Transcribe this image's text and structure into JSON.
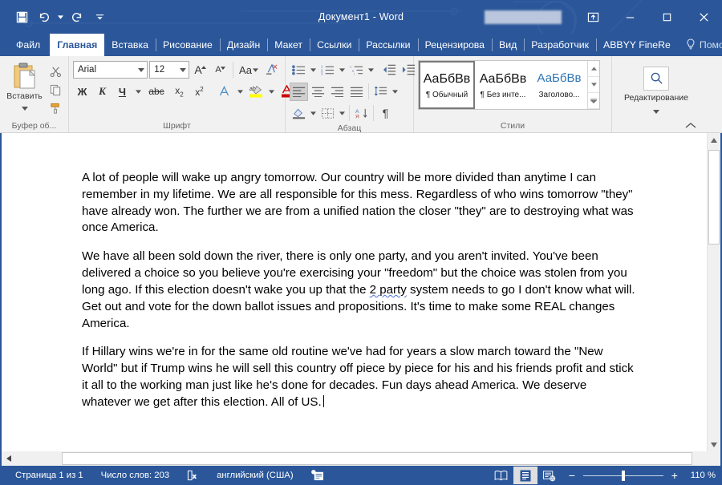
{
  "window": {
    "title": "Документ1  -  Word",
    "redacted_label": "",
    "quick_access": [
      {
        "name": "save",
        "icon": "save-icon"
      },
      {
        "name": "undo",
        "icon": "undo-icon"
      },
      {
        "name": "redo",
        "icon": "redo-icon"
      },
      {
        "name": "customize",
        "icon": "customize-qat-icon"
      }
    ],
    "controls": [
      {
        "name": "ribbon-display-options",
        "icon": "ribbon-options-icon"
      },
      {
        "name": "minimize",
        "icon": "minimize-icon"
      },
      {
        "name": "maximize",
        "icon": "maximize-icon"
      },
      {
        "name": "close",
        "icon": "close-icon"
      }
    ],
    "accent_color": "#2b579a"
  },
  "tabs": [
    {
      "label": "Файл",
      "active": false,
      "file": true
    },
    {
      "label": "Главная",
      "active": true
    },
    {
      "label": "Вставка",
      "active": false
    },
    {
      "label": "Рисование",
      "active": false
    },
    {
      "label": "Дизайн",
      "active": false
    },
    {
      "label": "Макет",
      "active": false
    },
    {
      "label": "Ссылки",
      "active": false
    },
    {
      "label": "Рассылки",
      "active": false
    },
    {
      "label": "Рецензирова",
      "active": false
    },
    {
      "label": "Вид",
      "active": false
    },
    {
      "label": "Разработчик",
      "active": false
    },
    {
      "label": "ABBYY FineRe",
      "active": false
    }
  ],
  "tell_me": {
    "label": "Помощн",
    "icon": "lightbulb-icon"
  },
  "account_icons": [
    {
      "name": "share-person-icon"
    },
    {
      "name": "comments-icon"
    }
  ],
  "ribbon": {
    "groups": {
      "clipboard": {
        "title": "Буфер об...",
        "paste_label": "Вставить",
        "buttons": [
          {
            "name": "cut",
            "icon": "scissors-icon"
          },
          {
            "name": "copy",
            "icon": "copy-icon"
          },
          {
            "name": "format-painter",
            "icon": "format-painter-icon"
          }
        ]
      },
      "font": {
        "title": "Шрифт",
        "font_family": "Arial",
        "font_size": "12",
        "buttons": [
          {
            "name": "grow-font",
            "label": "A"
          },
          {
            "name": "shrink-font",
            "label": "A"
          },
          {
            "name": "change-case",
            "label": "Aa"
          },
          {
            "name": "clear-formatting",
            "icon": "clear-format-icon"
          },
          {
            "name": "bold",
            "label": "Ж"
          },
          {
            "name": "italic",
            "label": "К"
          },
          {
            "name": "underline",
            "label": "Ч"
          },
          {
            "name": "strikethrough",
            "label": "abc"
          },
          {
            "name": "subscript",
            "label": "x"
          },
          {
            "name": "superscript",
            "label": "x"
          },
          {
            "name": "text-effects",
            "label": "A"
          },
          {
            "name": "text-highlight",
            "label": "ab"
          },
          {
            "name": "font-color",
            "label": "A"
          }
        ],
        "highlight_color": "#ffff00",
        "font_color": "#cc0000"
      },
      "paragraph": {
        "title": "Абзац",
        "buttons": [
          {
            "name": "bullets",
            "icon": "bullet-list-icon"
          },
          {
            "name": "numbering",
            "icon": "numbered-list-icon"
          },
          {
            "name": "multilevel-list",
            "icon": "multilevel-list-icon"
          },
          {
            "name": "decrease-indent",
            "icon": "decrease-indent-icon"
          },
          {
            "name": "increase-indent",
            "icon": "increase-indent-icon"
          },
          {
            "name": "align-left",
            "icon": "align-left-icon"
          },
          {
            "name": "align-center",
            "icon": "align-center-icon"
          },
          {
            "name": "align-right",
            "icon": "align-right-icon"
          },
          {
            "name": "justify",
            "icon": "justify-icon"
          },
          {
            "name": "line-spacing",
            "icon": "line-spacing-icon"
          },
          {
            "name": "shading",
            "icon": "shading-icon"
          },
          {
            "name": "borders",
            "icon": "borders-icon"
          },
          {
            "name": "sort",
            "icon": "sort-icon"
          },
          {
            "name": "show-marks",
            "icon": "pilcrow-icon"
          }
        ]
      },
      "styles": {
        "title": "Стили",
        "items": [
          {
            "preview": "АаБбВв",
            "name": "¶ Обычный",
            "selected": true
          },
          {
            "preview": "АаБбВв",
            "name": "¶ Без инте...",
            "selected": false
          },
          {
            "preview": "АаБбВв",
            "name": "Заголово...",
            "selected": false,
            "heading": true
          }
        ]
      },
      "editing": {
        "title": "",
        "label": "Редактирование",
        "icon": "magnifier-icon"
      }
    }
  },
  "document": {
    "paragraphs": [
      {
        "id": "p1",
        "text": "A lot of people will wake up angry tomorrow. Our country will be more divided than anytime I can remember in my lifetime. We are all responsible for this mess. Regardless of who wins tomorrow \"they\" have already won. The further we are from a unified nation the closer \"they\" are to destroying what was once America."
      },
      {
        "id": "p2a",
        "text": "We have all been sold down the river, there is only one party, and you aren't invited. You've been delivered a choice so you believe you're exercising your \"freedom\" but the choice was stolen from you long ago. If this election doesn't wake you up that the "
      },
      {
        "id": "p2b",
        "text": "2 party"
      },
      {
        "id": "p2c",
        "text": " system needs to go I don't know what will. Get out and vote for the down ballot issues and propositions. It's time to make some REAL changes America."
      },
      {
        "id": "p3",
        "text": "If Hillary wins we're in for the same old routine we've had for years a slow march toward the \"New World\" but if Trump wins he will sell this country off piece by piece for his and his friends profit and stick it all to the working man just like he's done for decades. Fun days ahead America. We deserve whatever we get after this election. All of US."
      }
    ]
  },
  "status_bar": {
    "page": "Страница 1 из 1",
    "word_count": "Число слов: 203",
    "proofing_icon": "proofing-errors-icon",
    "language": "английский (США)",
    "macro_icon": "macro-record-icon",
    "views": [
      {
        "name": "read-mode",
        "icon": "read-mode-icon",
        "active": false
      },
      {
        "name": "print-layout",
        "icon": "print-layout-icon",
        "active": true
      },
      {
        "name": "web-layout",
        "icon": "web-layout-icon",
        "active": false
      }
    ],
    "zoom_out": "−",
    "zoom_in": "+",
    "zoom_level": "110 %"
  }
}
